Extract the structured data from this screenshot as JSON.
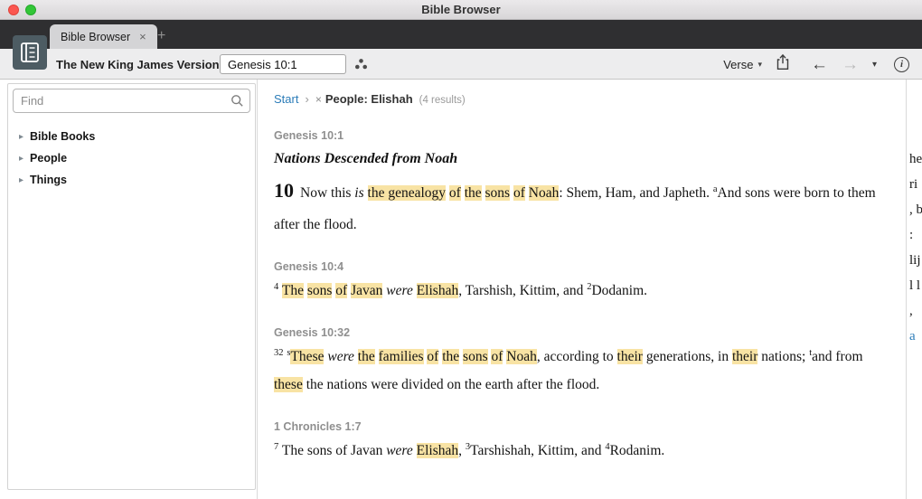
{
  "colors": {
    "accent": "#2b7cb8",
    "highlight": "#f8e3a4",
    "app_icon_bg": "#4d5c63"
  },
  "icons": {
    "caret": "▾",
    "back": "←",
    "forward": "→",
    "info": "i"
  },
  "window": {
    "title": "Bible Browser"
  },
  "tab_bar": {
    "active_tab": "Bible Browser",
    "close": "×",
    "new_tab": "+"
  },
  "toolbar": {
    "version": "The New King James Version",
    "reference": "Genesis 10:1",
    "display_mode": "Verse"
  },
  "sidebar": {
    "find_placeholder": "Find",
    "items": [
      {
        "label": "Bible Books"
      },
      {
        "label": "People"
      },
      {
        "label": "Things"
      }
    ]
  },
  "breadcrumb": {
    "start": "Start",
    "separator": "›",
    "remove": "×",
    "filter": "People: Elishah",
    "count": "(4 results)"
  },
  "results": [
    {
      "reference": "Genesis 10:1",
      "heading": "Nations Descended from Noah",
      "chapter_number": "10",
      "segments": [
        {
          "t": "Now this "
        },
        {
          "t": "is",
          "it": true
        },
        {
          "t": " "
        },
        {
          "t": "the genealogy",
          "hl": true
        },
        {
          "t": " "
        },
        {
          "t": "of",
          "hl": true
        },
        {
          "t": " "
        },
        {
          "t": "the",
          "hl": true
        },
        {
          "t": " "
        },
        {
          "t": "sons",
          "hl": true
        },
        {
          "t": " "
        },
        {
          "t": "of",
          "hl": true
        },
        {
          "t": " "
        },
        {
          "t": "Noah",
          "hl": true
        },
        {
          "t": ": Shem, Ham, and Japheth. "
        },
        {
          "t": "a",
          "sup": true
        },
        {
          "t": "And sons were born to them after the flood."
        }
      ]
    },
    {
      "reference": "Genesis 10:4",
      "segments": [
        {
          "t": "4",
          "sup": true
        },
        {
          "t": " "
        },
        {
          "t": "The",
          "hl": true
        },
        {
          "t": " "
        },
        {
          "t": "sons",
          "hl": true
        },
        {
          "t": " "
        },
        {
          "t": "of",
          "hl": true
        },
        {
          "t": " "
        },
        {
          "t": "Javan",
          "hl": true
        },
        {
          "t": " "
        },
        {
          "t": "were",
          "it": true
        },
        {
          "t": " "
        },
        {
          "t": "Elishah",
          "hl": true
        },
        {
          "t": ", Tarshish, Kittim, and "
        },
        {
          "t": "2",
          "sup": true
        },
        {
          "t": "Dodanim."
        }
      ]
    },
    {
      "reference": "Genesis 10:32",
      "segments": [
        {
          "t": "32",
          "sup": true
        },
        {
          "t": " "
        },
        {
          "t": "s",
          "sup": true
        },
        {
          "t": "These",
          "hl": true
        },
        {
          "t": " "
        },
        {
          "t": "were",
          "it": true
        },
        {
          "t": " "
        },
        {
          "t": "the",
          "hl": true
        },
        {
          "t": " "
        },
        {
          "t": "families",
          "hl": true
        },
        {
          "t": " "
        },
        {
          "t": "of",
          "hl": true
        },
        {
          "t": " "
        },
        {
          "t": "the",
          "hl": true
        },
        {
          "t": " "
        },
        {
          "t": "sons",
          "hl": true
        },
        {
          "t": " "
        },
        {
          "t": "of",
          "hl": true
        },
        {
          "t": " "
        },
        {
          "t": "Noah",
          "hl": true
        },
        {
          "t": ", according to "
        },
        {
          "t": "their",
          "hl": true
        },
        {
          "t": " generations, in "
        },
        {
          "t": "their",
          "hl": true
        },
        {
          "t": " nations; "
        },
        {
          "t": "t",
          "sup": true
        },
        {
          "t": "and from "
        },
        {
          "t": "these",
          "hl": true
        },
        {
          "t": " the nations were divided on the earth after the flood."
        }
      ]
    },
    {
      "reference": "1 Chronicles 1:7",
      "segments": [
        {
          "t": "7",
          "sup": true
        },
        {
          "t": " The sons of Javan "
        },
        {
          "t": "were",
          "it": true
        },
        {
          "t": " "
        },
        {
          "t": "Elishah",
          "hl": true
        },
        {
          "t": ", "
        },
        {
          "t": "3",
          "sup": true
        },
        {
          "t": "Tarshishah, Kittim, and "
        },
        {
          "t": "4",
          "sup": true
        },
        {
          "t": "Rodanim."
        }
      ]
    }
  ],
  "right_pane": {
    "fragments": [
      {
        "t": "he"
      },
      {
        "t": "ri"
      },
      {
        "t": ", b"
      },
      {
        "t": ":"
      },
      {
        "t": "lij"
      },
      {
        "t": "l l"
      },
      {
        "t": ","
      },
      {
        "t": "a",
        "blue": true
      }
    ]
  }
}
